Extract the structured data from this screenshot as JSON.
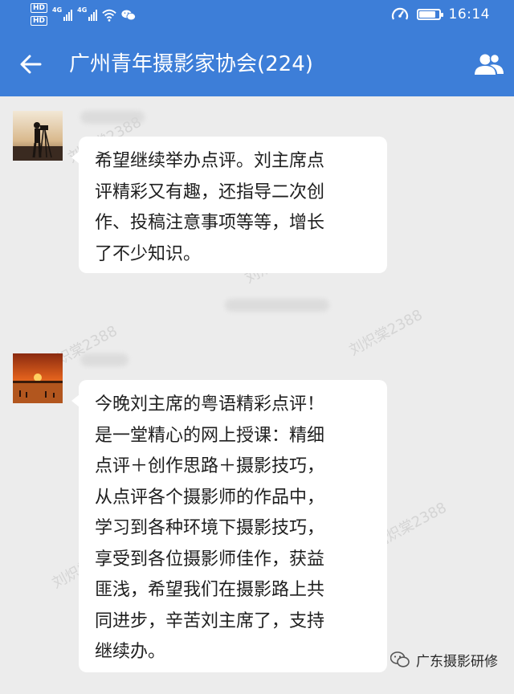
{
  "status_bar": {
    "hd_badges": [
      "HD",
      "HD"
    ],
    "network_labels": [
      "4G",
      "4G"
    ],
    "time": "16:14",
    "battery_level": 0.85
  },
  "header": {
    "title": "广州青年摄影家协会(224)",
    "background_color": "#3d7ed8"
  },
  "messages": [
    {
      "sender_name": "",
      "avatar": "photographer-silhouette-avatar",
      "lines": [
        "希望继续举办点评。刘主席点",
        "评精彩又有趣，还指导二次创",
        "作、投稿注意事项等等，增长",
        "了不少知识。"
      ]
    },
    {
      "sender_name": "",
      "avatar": "sunset-beach-avatar",
      "lines": [
        "今晚刘主席的粤语精彩点评！",
        "是一堂精心的网上授课：精细",
        "点评＋创作思路＋摄影技巧，",
        "从点评各个摄影师的作品中，",
        "学习到各种环境下摄影技巧，",
        "享受到各位摄影师佳作，获益",
        "匪浅，希望我们在摄影路上共",
        "同进步，辛苦刘主席了，支持",
        "继续办。"
      ]
    }
  ],
  "watermarks": [
    "刘炽棠2388",
    "刘炽棠2388",
    "刘炽棠2388",
    "刘炽棠2388",
    "刘炽棠2388",
    "刘炽棠2388"
  ],
  "footer": {
    "brand": "广东摄影研修"
  }
}
